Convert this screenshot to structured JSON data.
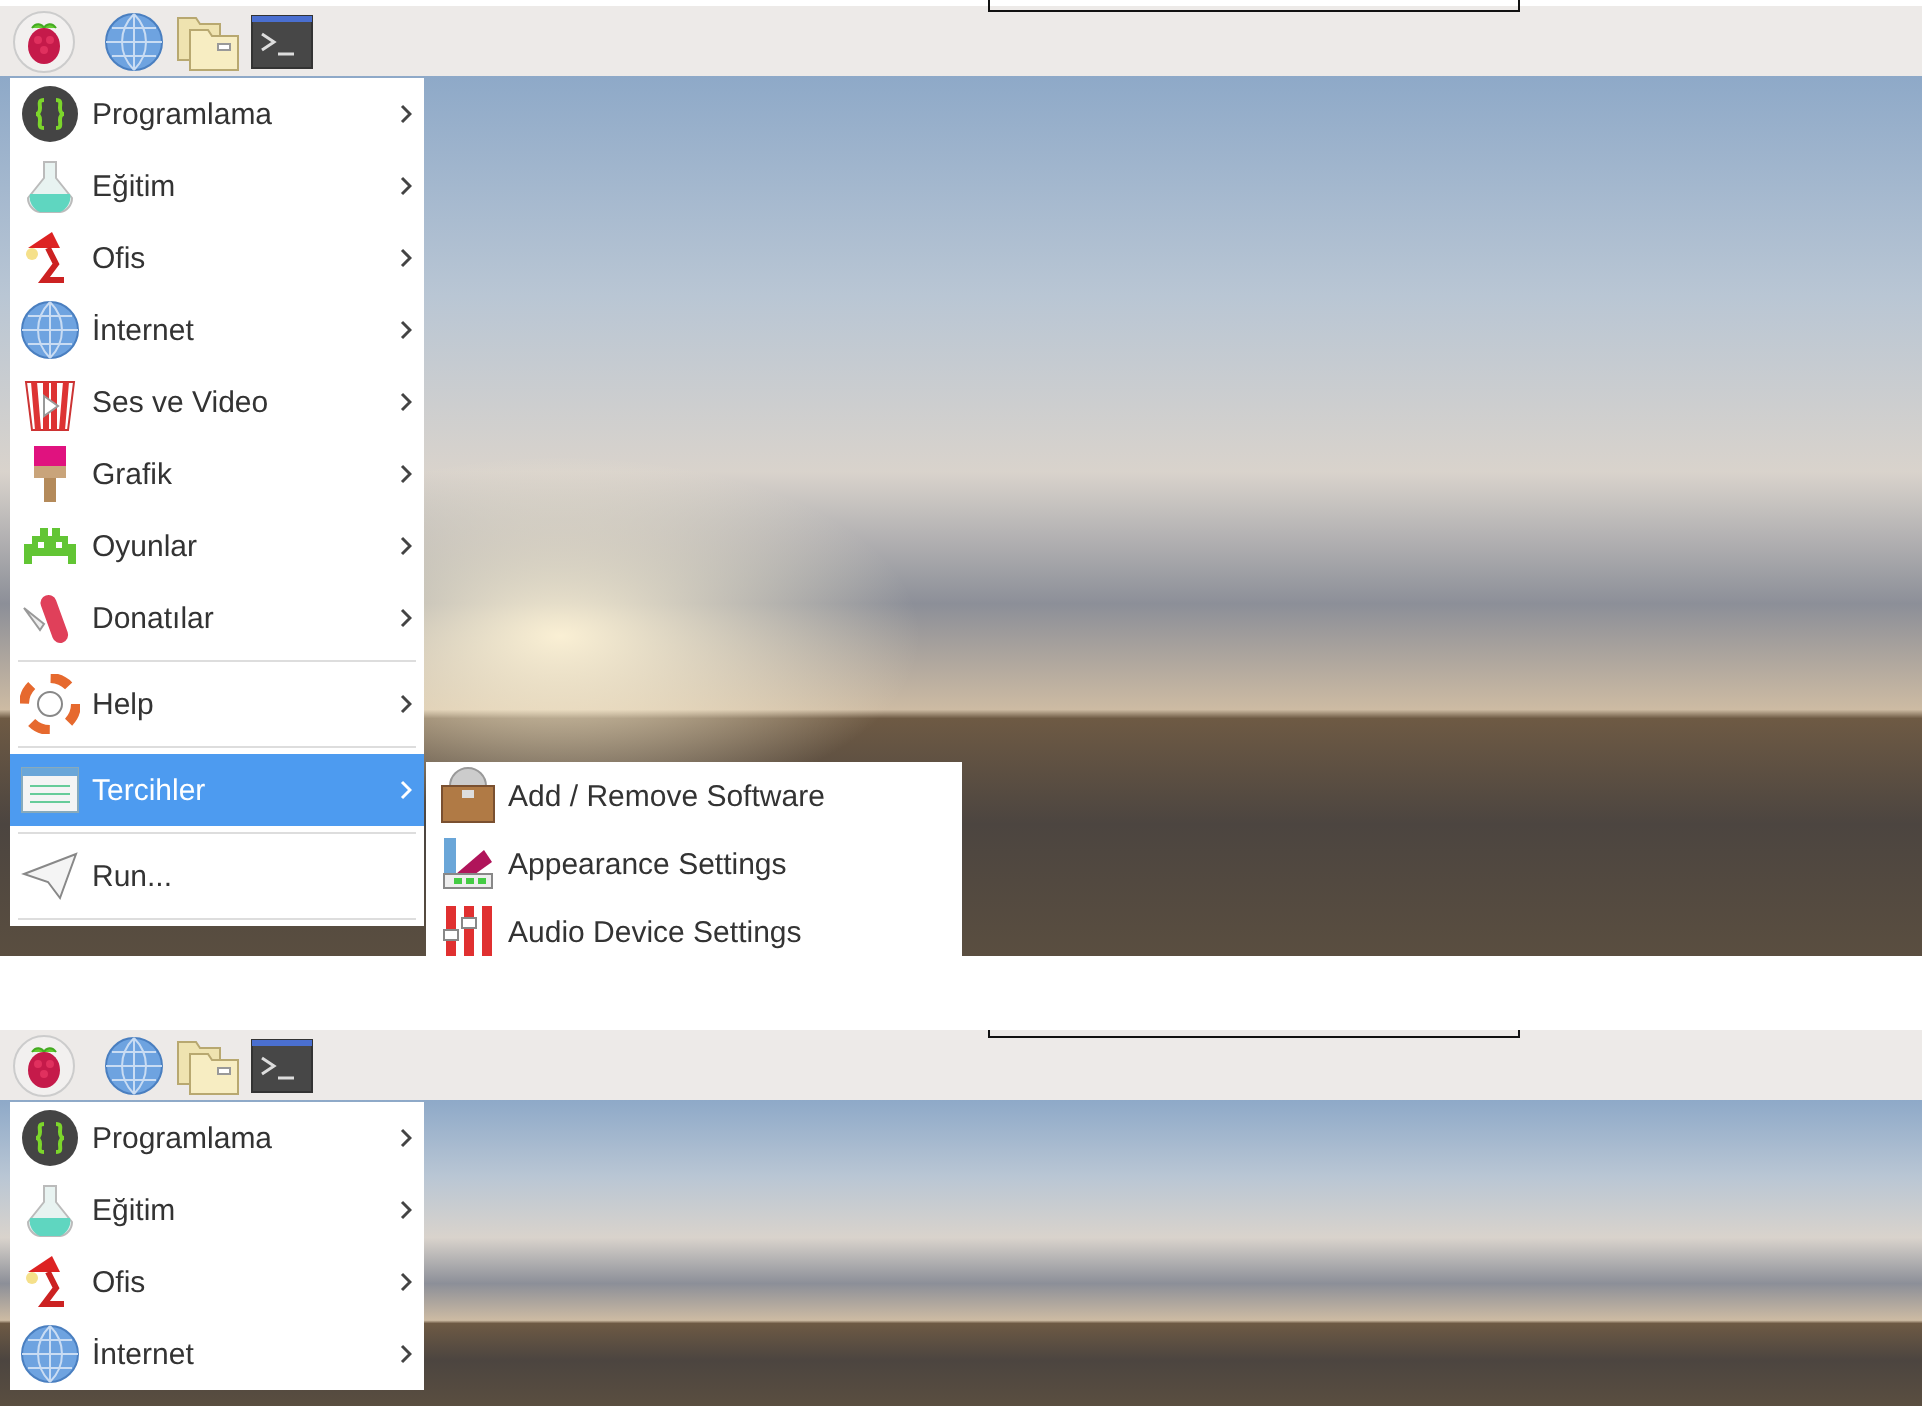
{
  "screenshots": [
    {
      "menu": {
        "items": [
          {
            "kind": "submenu",
            "label": "Programlama",
            "selected": false
          },
          {
            "kind": "submenu",
            "label": "Eğitim",
            "selected": false
          },
          {
            "kind": "submenu",
            "label": "Ofis",
            "selected": false
          },
          {
            "kind": "submenu",
            "label": "İnternet",
            "selected": false
          },
          {
            "kind": "submenu",
            "label": "Ses ve Video",
            "selected": false
          },
          {
            "kind": "submenu",
            "label": "Grafik",
            "selected": false
          },
          {
            "kind": "submenu",
            "label": "Oyunlar",
            "selected": false
          },
          {
            "kind": "submenu",
            "label": "Donatılar",
            "selected": false
          },
          {
            "kind": "separator"
          },
          {
            "kind": "submenu",
            "label": "Help",
            "selected": false
          },
          {
            "kind": "separator"
          },
          {
            "kind": "submenu",
            "label": "Tercihler",
            "selected": true
          },
          {
            "kind": "separator"
          },
          {
            "kind": "command",
            "label": "Run...",
            "selected": false
          },
          {
            "kind": "separator"
          }
        ]
      },
      "submenu": {
        "items": [
          {
            "label": "Add / Remove Software",
            "selected": false
          },
          {
            "label": "Appearance Settings",
            "selected": false
          },
          {
            "label": "Audio Device Settings",
            "selected": false
          }
        ]
      }
    },
    {
      "menu": {
        "items": [
          {
            "kind": "submenu",
            "label": "Programlama",
            "selected": false
          },
          {
            "kind": "submenu",
            "label": "Eğitim",
            "selected": false
          },
          {
            "kind": "submenu",
            "label": "Ofis",
            "selected": false
          },
          {
            "kind": "submenu",
            "label": "İnternet",
            "selected": false
          }
        ]
      }
    }
  ]
}
